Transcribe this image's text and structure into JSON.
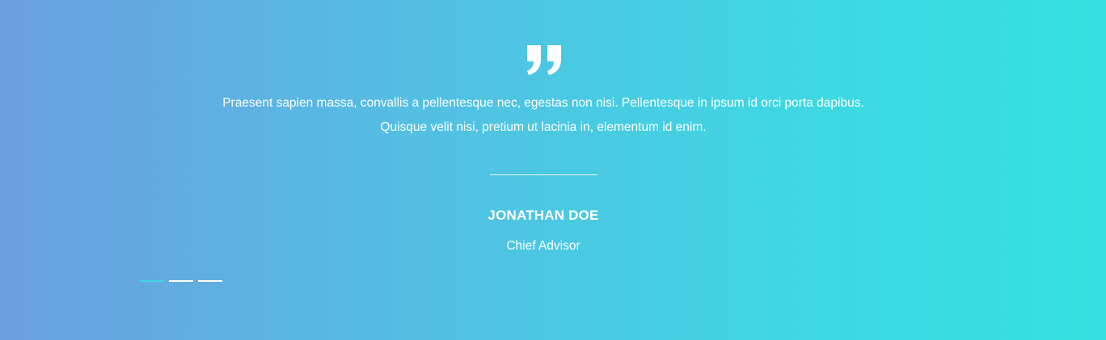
{
  "testimonial": {
    "quote_icon": "quote-mark-icon",
    "text": "Praesent sapien massa, convallis a pellentesque nec, egestas non nisi. Pellentesque in ipsum id orci porta dapibus. Quisque velit nisi, pretium ut lacinia in, elementum id enim.",
    "author_name": "JONATHAN DOE",
    "author_role": "Chief Advisor"
  },
  "slider": {
    "slide_count": 3,
    "active_index": 0,
    "active_color": "#40d6e2",
    "inactive_color": "#ffffff"
  },
  "colors": {
    "gradient_start": "#6b9fe1",
    "gradient_end": "#34e1e1",
    "text": "#ffffff"
  }
}
